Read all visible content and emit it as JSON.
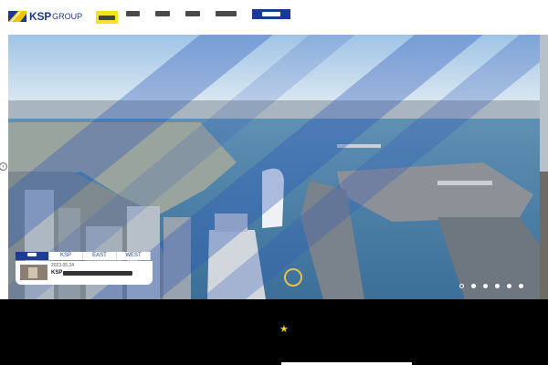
{
  "header": {
    "logo": {
      "name": "KSP",
      "suffix": "GROUP",
      "icon": "ksp-logo-mark-icon"
    },
    "nav": {
      "active_index": 0,
      "items": [
        {
          "id": "nav-item-1"
        },
        {
          "id": "nav-item-2"
        },
        {
          "id": "nav-item-3"
        },
        {
          "id": "nav-item-4"
        },
        {
          "id": "nav-item-5"
        }
      ],
      "cta": {
        "id": "nav-cta"
      }
    }
  },
  "hero": {
    "image": "aerial-city-bay-photo",
    "overlay": "translucent-blue-diagonal-stripes",
    "prev_arrow": "chevron-left-icon",
    "news": {
      "tabs": [
        {
          "label": ""
        },
        {
          "label": "KSP"
        },
        {
          "label": "EAST"
        },
        {
          "label": "WEST"
        }
      ],
      "active_tab": 0,
      "item": {
        "date": "2023.05.24",
        "title_visible": "KSP"
      }
    },
    "slider": {
      "count": 6,
      "active": 0
    }
  },
  "footer_band": {
    "icon": "star-icon"
  },
  "colors": {
    "brand_blue": "#1c3a8c",
    "nav_button": "#1a3a96",
    "nav_active": "#f3e320",
    "star": "#f0d400",
    "band": "#000000"
  }
}
